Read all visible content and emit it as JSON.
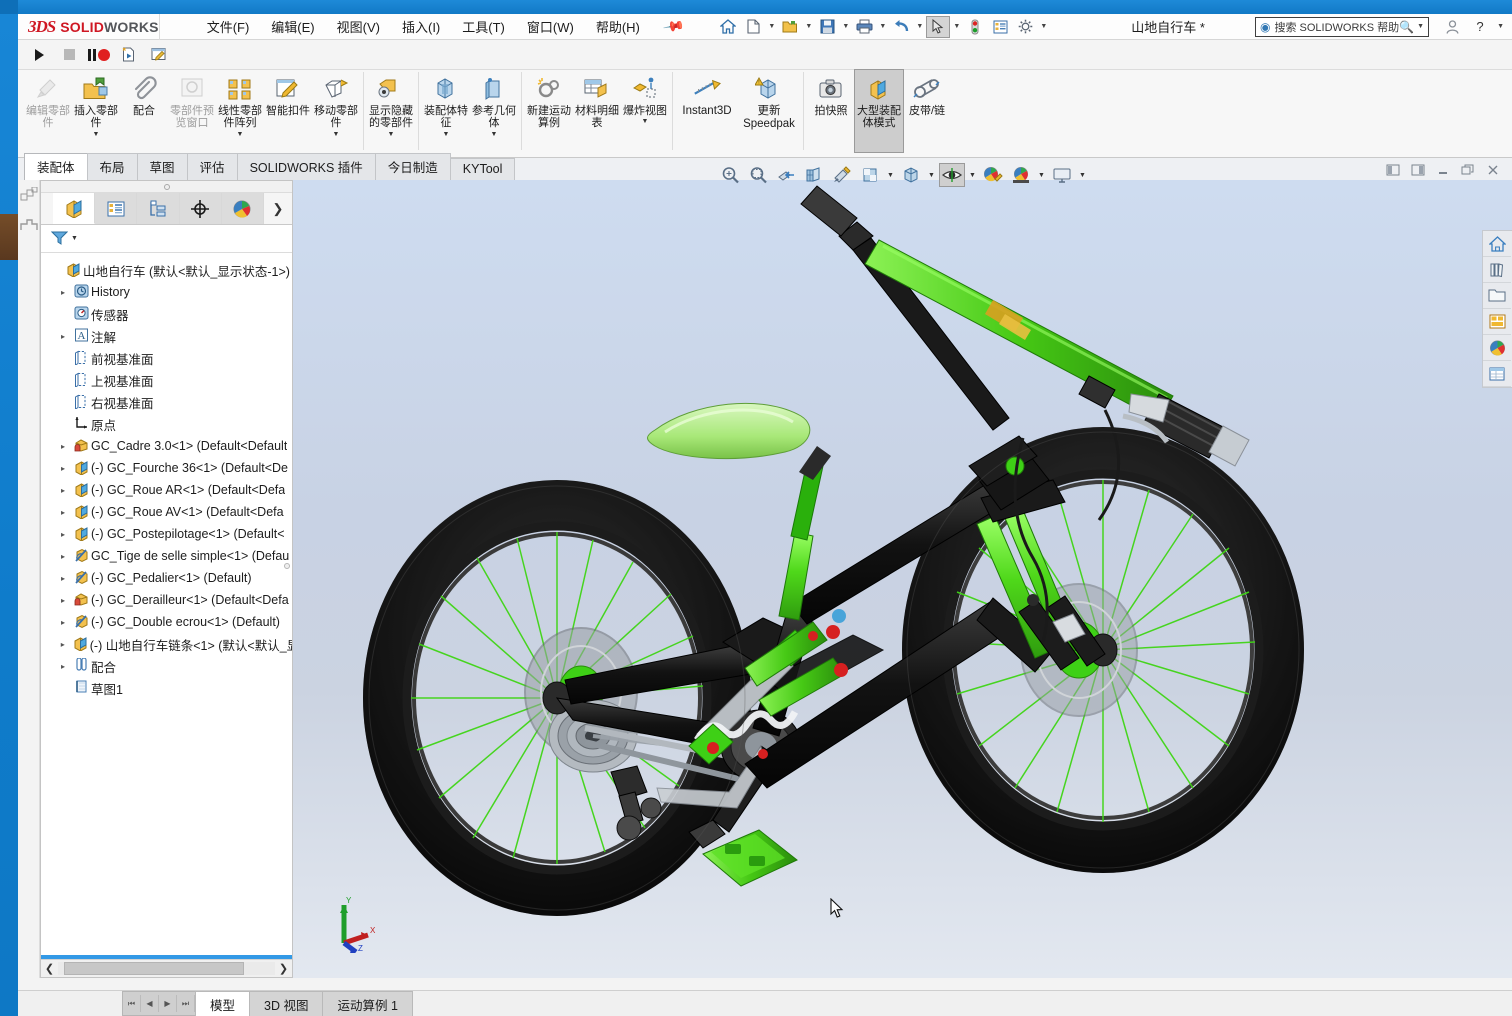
{
  "app": {
    "brand_3ds": "3DS",
    "brand_solid": "SOLID",
    "brand_works": "WORKS",
    "document_title": "山地自行车 *"
  },
  "menu": {
    "items": [
      {
        "label": "文件(F)",
        "name": "menu-file"
      },
      {
        "label": "编辑(E)",
        "name": "menu-edit"
      },
      {
        "label": "视图(V)",
        "name": "menu-view"
      },
      {
        "label": "插入(I)",
        "name": "menu-insert"
      },
      {
        "label": "工具(T)",
        "name": "menu-tools"
      },
      {
        "label": "窗口(W)",
        "name": "menu-window"
      },
      {
        "label": "帮助(H)",
        "name": "menu-help"
      }
    ],
    "pin_icon": "pushpin-icon"
  },
  "quick_access": {
    "buttons": [
      {
        "icon": "🏠",
        "name": "home-icon",
        "caret": false
      },
      {
        "icon": "🗋",
        "name": "new-document-icon",
        "caret": true
      },
      {
        "icon": "📂",
        "name": "open-folder-icon",
        "caret": true
      },
      {
        "icon": "💾",
        "name": "save-icon",
        "caret": true
      },
      {
        "icon": "🖨",
        "name": "print-icon",
        "caret": true
      },
      {
        "icon": "↩",
        "name": "undo-icon",
        "caret": true
      },
      {
        "icon": "⬉",
        "name": "select-cursor-icon",
        "caret": true,
        "selected": true
      },
      {
        "icon": "🚦",
        "name": "traffic-light-icon",
        "caret": false
      },
      {
        "icon": "▤",
        "name": "options-list-icon",
        "caret": false
      },
      {
        "icon": "⚙",
        "name": "gear-icon",
        "caret": true
      }
    ]
  },
  "help_search": {
    "question_icon": "question-circle-icon",
    "placeholder": "搜索 SOLIDWORKS 帮助",
    "magnifier_icon": "magnifier-icon"
  },
  "window_controls": {
    "account": "👤",
    "help": "?",
    "minimize": "—",
    "maximize": "❐",
    "close": "✕"
  },
  "toolbar2": {
    "buttons": [
      {
        "icon": "▶",
        "name": "play-button"
      },
      {
        "icon": "■",
        "name": "stop-button"
      },
      {
        "icon": "❚❚",
        "name": "pause-button"
      },
      {
        "icon": "●",
        "name": "record-button"
      },
      {
        "icon": "🗎",
        "name": "macro-new-icon"
      },
      {
        "icon": "🖉",
        "name": "macro-edit-icon"
      }
    ]
  },
  "ribbon": {
    "groups": [
      {
        "buttons": [
          {
            "label": "编辑零部件",
            "name": "edit-component-button",
            "icon": "✎",
            "disabled": true,
            "caret": false
          },
          {
            "label": "插入零部件",
            "name": "insert-component-button",
            "icon": "📥",
            "disabled": false,
            "caret": true
          },
          {
            "label": "配合",
            "name": "mate-button",
            "icon": "📎",
            "disabled": false,
            "caret": false
          },
          {
            "label": "零部件预览窗口",
            "name": "component-preview-window-button",
            "icon": "🗔",
            "disabled": true,
            "caret": false
          },
          {
            "label": "线性零部件阵列",
            "name": "linear-component-pattern-button",
            "icon": "▣",
            "disabled": false,
            "caret": true
          },
          {
            "label": "智能扣件",
            "name": "smart-fasteners-button",
            "icon": "🔩",
            "disabled": false,
            "caret": false
          },
          {
            "label": "移动零部件",
            "name": "move-component-button",
            "icon": "✥",
            "disabled": false,
            "caret": true
          },
          {
            "label": "显示隐藏的零部件",
            "name": "show-hidden-components-button",
            "icon": "👁",
            "disabled": false,
            "caret": true
          }
        ]
      },
      {
        "buttons": [
          {
            "label": "装配体特征",
            "name": "assembly-features-button",
            "icon": "🧊",
            "disabled": false,
            "caret": true
          },
          {
            "label": "参考几何体",
            "name": "reference-geometry-button",
            "icon": "⌗",
            "disabled": false,
            "caret": true
          }
        ]
      },
      {
        "buttons": [
          {
            "label": "新建运动算例",
            "name": "new-motion-study-button",
            "icon": "⚙",
            "disabled": false,
            "caret": false
          },
          {
            "label": "材料明细表",
            "name": "bill-of-materials-button",
            "icon": "▦",
            "disabled": false,
            "caret": false
          },
          {
            "label": "爆炸视图",
            "name": "exploded-view-button",
            "icon": "✦",
            "disabled": false,
            "caret": true
          }
        ]
      },
      {
        "buttons": [
          {
            "label": "Instant3D",
            "name": "instant3d-button",
            "icon": "📏",
            "disabled": false,
            "caret": false,
            "english": true
          },
          {
            "label": "更新 Speedpak",
            "name": "update-speedpak-button",
            "icon": "⚠",
            "disabled": false,
            "caret": false
          }
        ]
      },
      {
        "buttons": [
          {
            "label": "拍快照",
            "name": "take-snapshot-button",
            "icon": "📷",
            "disabled": false,
            "caret": false
          },
          {
            "label": "大型装配体模式",
            "name": "large-assembly-mode-button",
            "icon": "🧊",
            "disabled": false,
            "caret": false,
            "active": true
          },
          {
            "label": "皮带/链",
            "name": "belt-chain-button",
            "icon": "⛓",
            "disabled": false,
            "caret": false
          }
        ]
      }
    ]
  },
  "command_tabs": [
    {
      "label": "装配体",
      "name": "tab-assembly",
      "selected": true
    },
    {
      "label": "布局",
      "name": "tab-layout",
      "selected": false
    },
    {
      "label": "草图",
      "name": "tab-sketch",
      "selected": false
    },
    {
      "label": "评估",
      "name": "tab-evaluate",
      "selected": false
    },
    {
      "label": "SOLIDWORKS 插件",
      "name": "tab-solidworks-addins",
      "selected": false
    },
    {
      "label": "今日制造",
      "name": "tab-manufacturing-today",
      "selected": false
    },
    {
      "label": "KYTool",
      "name": "tab-kytool",
      "selected": false
    }
  ],
  "feature_manager": {
    "tabs": [
      {
        "icon": "🧊",
        "name": "featuremanager-design-tree-tab",
        "selected": true
      },
      {
        "icon": "▤",
        "name": "property-manager-tab",
        "selected": false
      },
      {
        "icon": "⚙",
        "name": "configuration-manager-tab",
        "selected": false
      },
      {
        "icon": "✛",
        "name": "dimxpert-manager-tab",
        "selected": false
      },
      {
        "icon": "🎨",
        "name": "display-manager-tab",
        "selected": false
      }
    ],
    "more_icon": "chevron-right-icon",
    "filter_icon": "filter-icon",
    "tree": [
      {
        "label": "山地自行车  (默认<默认_显示状态-1>)",
        "icon": "🧊",
        "indent": 0,
        "expand": "",
        "name": "tree-root-assembly"
      },
      {
        "label": "History",
        "icon": "🕘",
        "indent": 1,
        "expand": "▸",
        "name": "tree-item-history"
      },
      {
        "label": "传感器",
        "icon": "◎",
        "indent": 1,
        "expand": "",
        "name": "tree-item-sensors"
      },
      {
        "label": "注解",
        "icon": "🅰",
        "indent": 1,
        "expand": "▸",
        "name": "tree-item-annotations"
      },
      {
        "label": "前视基准面",
        "icon": "▯",
        "indent": 1,
        "expand": "",
        "name": "tree-item-front-plane"
      },
      {
        "label": "上视基准面",
        "icon": "▯",
        "indent": 1,
        "expand": "",
        "name": "tree-item-top-plane"
      },
      {
        "label": "右视基准面",
        "icon": "▯",
        "indent": 1,
        "expand": "",
        "name": "tree-item-right-plane"
      },
      {
        "label": "原点",
        "icon": "⌐",
        "indent": 1,
        "expand": "",
        "name": "tree-item-origin"
      },
      {
        "label": "GC_Cadre 3.0<1>  (Default<Default",
        "icon": "🔶",
        "indent": 1,
        "expand": "▸",
        "name": "tree-item-gc-cadre"
      },
      {
        "label": "(-) GC_Fourche 36<1>  (Default<De",
        "icon": "🧊",
        "indent": 1,
        "expand": "▸",
        "name": "tree-item-gc-fourche"
      },
      {
        "label": "(-) GC_Roue AR<1>  (Default<Defa",
        "icon": "🧊",
        "indent": 1,
        "expand": "▸",
        "name": "tree-item-gc-roue-ar"
      },
      {
        "label": "(-) GC_Roue AV<1>  (Default<Defa",
        "icon": "🧊",
        "indent": 1,
        "expand": "▸",
        "name": "tree-item-gc-roue-av"
      },
      {
        "label": "(-) GC_Postepilotage<1>  (Default<",
        "icon": "🧊",
        "indent": 1,
        "expand": "▸",
        "name": "tree-item-gc-postepilotage"
      },
      {
        "label": "GC_Tige de selle simple<1>  (Defau",
        "icon": "🪶",
        "indent": 1,
        "expand": "▸",
        "name": "tree-item-gc-tige-de-selle"
      },
      {
        "label": "(-) GC_Pedalier<1>  (Default)",
        "icon": "🪶",
        "indent": 1,
        "expand": "▸",
        "name": "tree-item-gc-pedalier"
      },
      {
        "label": "(-) GC_Derailleur<1>  (Default<Defa",
        "icon": "🔶",
        "indent": 1,
        "expand": "▸",
        "name": "tree-item-gc-derailleur"
      },
      {
        "label": "(-) GC_Double ecrou<1>  (Default)",
        "icon": "🪶",
        "indent": 1,
        "expand": "▸",
        "name": "tree-item-gc-double-ecrou"
      },
      {
        "label": "(-) 山地自行车链条<1>  (默认<默认_显",
        "icon": "🧊",
        "indent": 1,
        "expand": "▸",
        "name": "tree-item-bike-chain"
      },
      {
        "label": "配合",
        "icon": "📎",
        "indent": 1,
        "expand": "▸",
        "name": "tree-item-mates"
      },
      {
        "label": "草图1",
        "icon": "▢",
        "indent": 1,
        "expand": "",
        "name": "tree-item-sketch1"
      }
    ],
    "scroll_left_icon": "chevron-left-icon",
    "scroll_right_icon": "chevron-right-icon"
  },
  "view_toolbar": {
    "buttons": [
      {
        "icon": "🔍",
        "name": "zoom-to-fit-icon",
        "caret": false
      },
      {
        "icon": "🔎",
        "name": "zoom-to-area-icon",
        "caret": false
      },
      {
        "icon": "✂",
        "name": "section-view-icon",
        "caret": false
      },
      {
        "icon": "⬓",
        "name": "view-orientation-icon",
        "caret": false
      },
      {
        "icon": "🖌",
        "name": "apply-scene-icon",
        "caret": false
      },
      {
        "icon": "▣",
        "name": "view-settings-icon",
        "caret": true
      },
      {
        "icon": "🧊",
        "name": "display-style-icon",
        "caret": true
      },
      {
        "icon": "👁",
        "name": "hide-show-items-icon",
        "caret": true,
        "selected": true
      },
      {
        "icon": "🎨",
        "name": "edit-appearance-icon",
        "caret": false
      },
      {
        "icon": "🌈",
        "name": "apply-scene-palette-icon",
        "caret": true
      },
      {
        "icon": "🖥",
        "name": "view-setting-display-icon",
        "caret": true
      }
    ],
    "right_buttons": [
      {
        "icon": "◧",
        "name": "restore-panel-left-icon"
      },
      {
        "icon": "◨",
        "name": "restore-panel-right-icon"
      },
      {
        "icon": "—",
        "name": "minimize-document-icon"
      },
      {
        "icon": "❐",
        "name": "restore-document-icon"
      },
      {
        "icon": "✕",
        "name": "close-document-icon"
      }
    ]
  },
  "right_dock": [
    {
      "icon": "🏠",
      "name": "design-library-home-icon"
    },
    {
      "icon": "📚",
      "name": "design-library-icon"
    },
    {
      "icon": "📁",
      "name": "file-explorer-icon"
    },
    {
      "icon": "🗂",
      "name": "view-palette-icon"
    },
    {
      "icon": "🎨",
      "name": "appearances-scenes-icon"
    },
    {
      "icon": "▤",
      "name": "custom-properties-icon"
    }
  ],
  "left_toolbar": [
    {
      "icon": "⛰",
      "name": "weldment-icon"
    },
    {
      "icon": "⊓",
      "name": "structural-member-icon"
    }
  ],
  "bottom": {
    "nav_buttons": [
      "⏮",
      "◀",
      "▶",
      "⏭"
    ],
    "tabs": [
      {
        "label": "模型",
        "name": "bottom-tab-model",
        "selected": true
      },
      {
        "label": "3D 视图",
        "name": "bottom-tab-3d-views",
        "selected": false
      },
      {
        "label": "运动算例 1",
        "name": "bottom-tab-motion-study-1",
        "selected": false
      }
    ]
  },
  "viewport": {
    "triad_labels": {
      "x": "X",
      "y": "Y",
      "z": "Z"
    },
    "cursor_icon": "mouse-pointer-icon",
    "model_name": "山地自行车",
    "colors": {
      "bg_top": "#cedcf0",
      "bg_bottom": "#e3e8f0",
      "accent_green": "#55e021",
      "frame_black": "#141414",
      "tire_black": "#1c1c1c",
      "spoke_green": "#4ddb20",
      "rim_dark": "#2a2a2a"
    }
  }
}
